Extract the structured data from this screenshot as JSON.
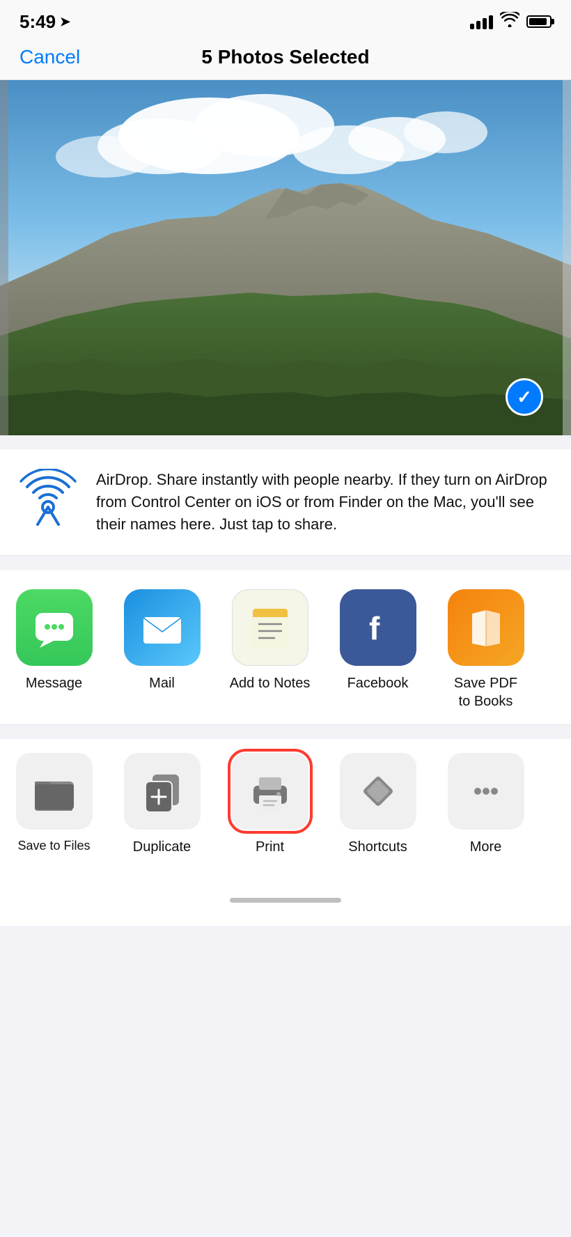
{
  "status": {
    "time": "5:49",
    "has_location": true
  },
  "nav": {
    "cancel_label": "Cancel",
    "title": "5 Photos Selected"
  },
  "airdrop": {
    "title": "AirDrop",
    "description": "AirDrop. Share instantly with people nearby. If they turn on AirDrop from Control Center on iOS or from Finder on the Mac, you'll see their names here. Just tap to share."
  },
  "apps": [
    {
      "id": "message",
      "label": "Message"
    },
    {
      "id": "mail",
      "label": "Mail"
    },
    {
      "id": "notes",
      "label": "Add to Notes"
    },
    {
      "id": "facebook",
      "label": "Facebook"
    },
    {
      "id": "savepdf",
      "label": "Save PDF\nto Books"
    }
  ],
  "actions": [
    {
      "id": "save-to-files",
      "label": "Save to Files"
    },
    {
      "id": "duplicate",
      "label": "Duplicate"
    },
    {
      "id": "print",
      "label": "Print",
      "highlighted": true
    },
    {
      "id": "shortcuts",
      "label": "Shortcuts"
    },
    {
      "id": "more",
      "label": "More"
    }
  ]
}
